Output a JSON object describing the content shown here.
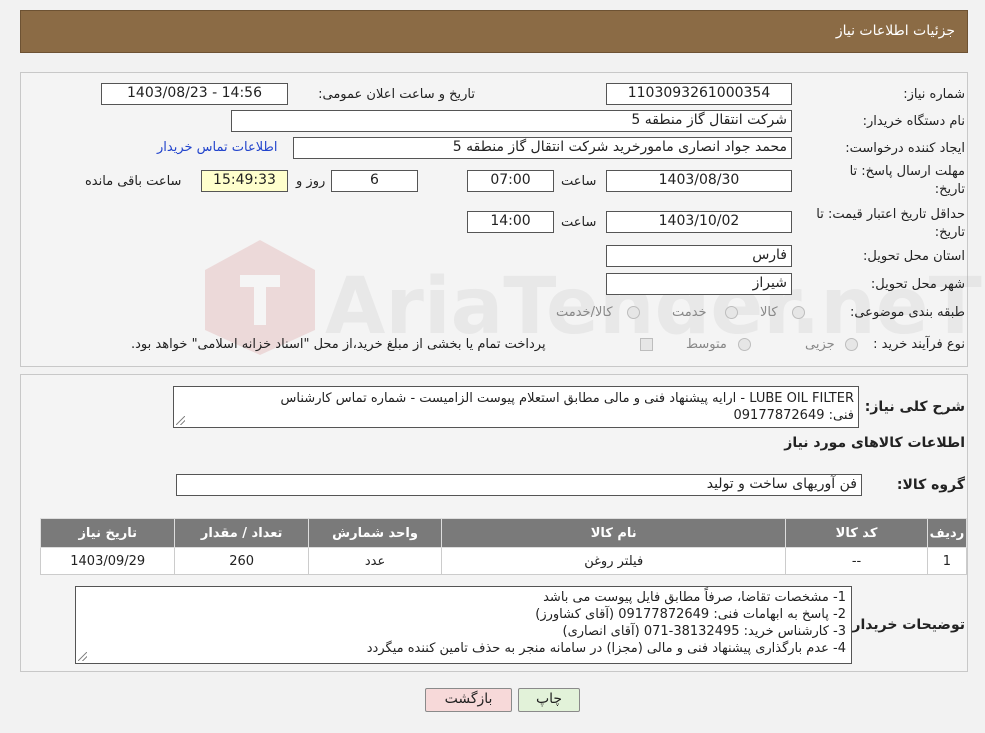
{
  "header": {
    "title": "جزئیات اطلاعات نیاز"
  },
  "form": {
    "need_number_label": "شماره نیاز:",
    "need_number": "1103093261000354",
    "announce_label": "تاریخ و ساعت اعلان عمومی:",
    "announce_value": "1403/08/23 - 14:56",
    "buyer_org_label": "نام دستگاه خریدار:",
    "buyer_org": "شرکت انتقال گاز منطقه 5",
    "creator_label": "ایجاد کننده درخواست:",
    "creator": "محمد جواد انصاری مامورخرید شرکت انتقال گاز منطقه 5",
    "contact_link": "اطلاعات تماس خریدار",
    "deadline_label_1": "مهلت ارسال پاسخ: تا",
    "deadline_label_2": "تاریخ:",
    "deadline_date": "1403/08/30",
    "time_label": "ساعت",
    "deadline_time": "07:00",
    "days_value": "6",
    "days_label": "روز و",
    "remaining_time": "15:49:33",
    "remaining_label": "ساعت باقی مانده",
    "validity_label_1": "حداقل تاریخ اعتبار قیمت: تا",
    "validity_label_2": "تاریخ:",
    "validity_date": "1403/10/02",
    "validity_time": "14:00",
    "province_label": "استان محل تحویل:",
    "province": "فارس",
    "city_label": "شهر محل تحویل:",
    "city": "شیراز",
    "category_label": "طبقه بندی موضوعی:",
    "category_options": [
      "کالا",
      "خدمت",
      "کالا/خدمت"
    ],
    "process_label": "نوع فرآیند خرید :",
    "process_options": [
      "جزیی",
      "متوسط"
    ],
    "process_note": "پرداخت تمام یا بخشی از مبلغ خرید،از محل \"اسناد خزانه اسلامی\" خواهد بود."
  },
  "summary": {
    "label": "شرح کلی نیاز:",
    "text_line1": "LUBE OIL FILTER  - ارایه پیشنهاد فنی و مالی مطابق استعلام پیوست الزامیست - شماره تماس کارشناس",
    "text_line2": "فنی: 09177872649",
    "goods_info_title": "اطلاعات کالاهای مورد نیاز",
    "group_label": "گروه کالا:",
    "group_value": "فن آوریهای ساخت و تولید"
  },
  "table": {
    "headers": [
      "ردیف",
      "کد کالا",
      "نام کالا",
      "واحد شمارش",
      "تعداد / مقدار",
      "تاریخ نیاز"
    ],
    "rows": [
      [
        "1",
        "--",
        "فیلتر روغن",
        "عدد",
        "260",
        "1403/09/29"
      ]
    ]
  },
  "buyer_notes": {
    "label": "توضیحات خریدار:",
    "lines": [
      "1-  مشخصات تقاضا، صرفاً مطابق فایل پیوست می باشد",
      "2- پاسخ به ابهامات فنی: 09177872649 (آقای کشاورز)",
      "3- کارشناس خرید: 38132495-071 (آقای انصاری)",
      "4- عدم بارگذاری پیشنهاد فنی و مالی (مجزا) در سامانه منجر به حذف تامین کننده میگردد"
    ]
  },
  "buttons": {
    "print": "چاپ",
    "back": "بازگشت"
  },
  "watermark": {
    "text": "AriaTender.neT"
  },
  "colors": {
    "header": "#8b6b45",
    "back_button": "#f7d9d9",
    "print_button": "#e2f2d9",
    "link": "#2244cc"
  }
}
